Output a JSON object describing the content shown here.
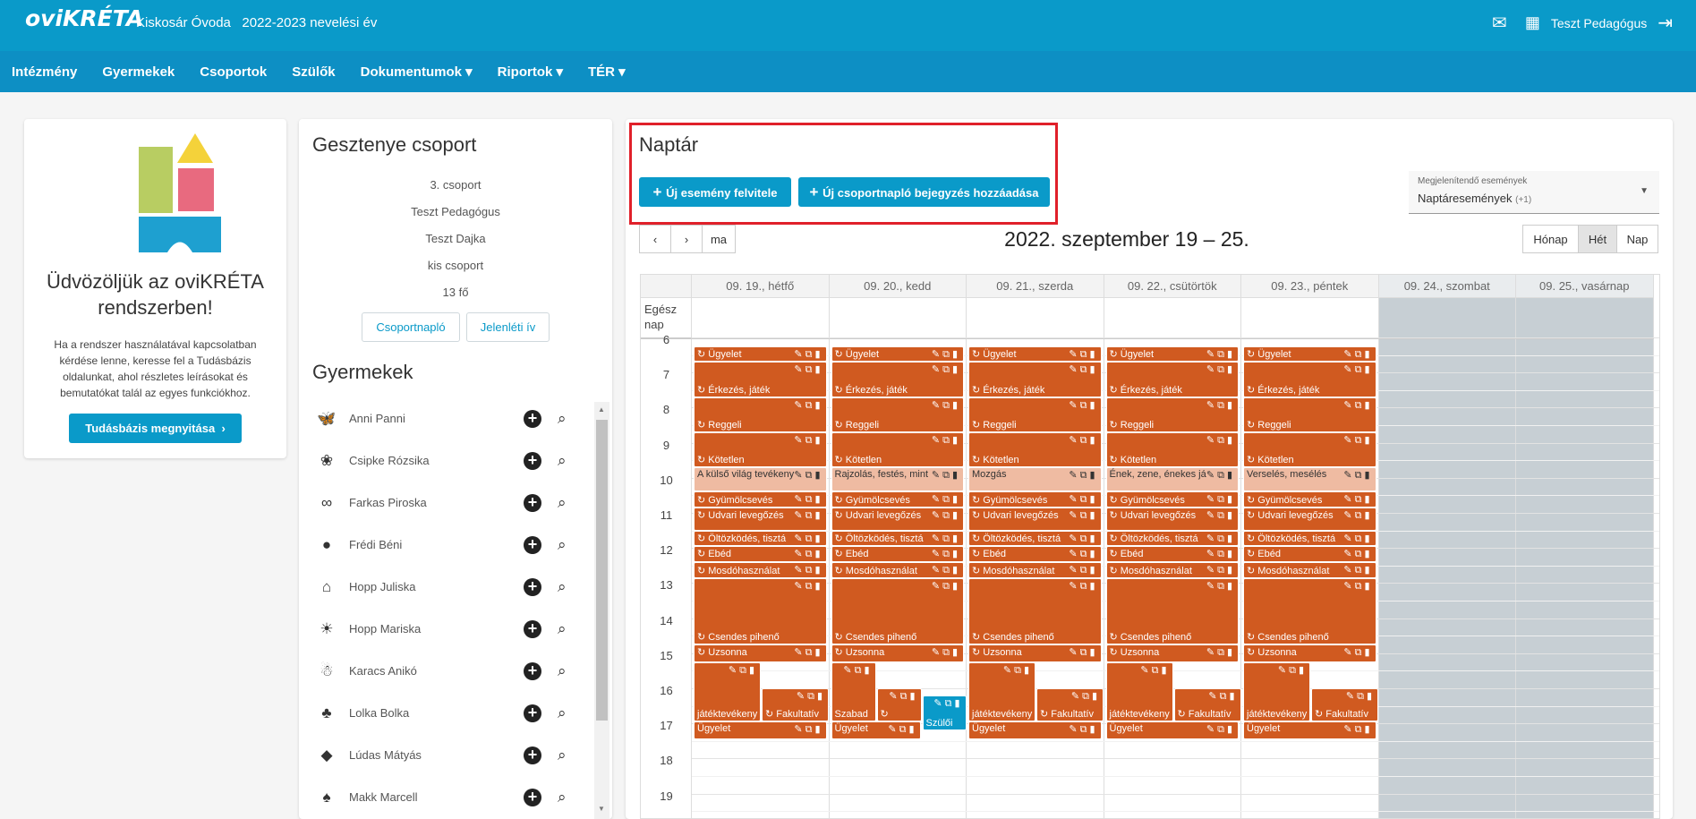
{
  "header": {
    "logo": "oviKRÉTA",
    "institution": "Kiskosár Óvoda",
    "year": "2022-2023 nevelési év",
    "user": "Teszt Pedagógus"
  },
  "nav": [
    {
      "label": "Intézmény"
    },
    {
      "label": "Gyermekek"
    },
    {
      "label": "Csoportok"
    },
    {
      "label": "Szülők"
    },
    {
      "label": "Dokumentumok ▾"
    },
    {
      "label": "Riportok ▾"
    },
    {
      "label": "TÉR ▾"
    }
  ],
  "welcome": {
    "title": "Üdvözöljük az oviKRÉTA rendszerben!",
    "text": "Ha a rendszer használatával kapcsolatban kérdése lenne, keresse fel a Tudásbázis oldalunkat, ahol részletes leírásokat és bemutatókat talál az egyes funkciókhoz.",
    "button": "Tudásbázis megnyitása"
  },
  "group": {
    "title": "Gesztenye csoport",
    "info": [
      "3. csoport",
      "Teszt Pedagógus",
      "Teszt Dajka",
      "kis csoport",
      "13 fő"
    ],
    "btn_naplo": "Csoportnapló",
    "btn_jelenleti": "Jelenléti ív",
    "children_title": "Gyermekek",
    "children": [
      {
        "name": "Anni Panni",
        "icon": "butterfly-icon",
        "glyph": "🦋"
      },
      {
        "name": "Csipke Rózsika",
        "icon": "flower-icon",
        "glyph": "❀"
      },
      {
        "name": "Farkas Piroska",
        "icon": "pretzel-icon",
        "glyph": "∞"
      },
      {
        "name": "Frédi Béni",
        "icon": "apple-icon",
        "glyph": "●"
      },
      {
        "name": "Hopp Juliska",
        "icon": "house-icon",
        "glyph": "⌂"
      },
      {
        "name": "Hopp Mariska",
        "icon": "sun-icon",
        "glyph": "☀"
      },
      {
        "name": "Karacs Anikó",
        "icon": "snowman-icon",
        "glyph": "☃"
      },
      {
        "name": "Lolka Bolka",
        "icon": "mushroom-icon",
        "glyph": "♣"
      },
      {
        "name": "Lúdas Mátyás",
        "icon": "duck-icon",
        "glyph": "◆"
      },
      {
        "name": "Makk Marcell",
        "icon": "tree-icon",
        "glyph": "♠"
      }
    ]
  },
  "calendar": {
    "title": "Naptár",
    "btn_new_event": "Új esemény felvitele",
    "btn_new_entry": "Új csoportnapló bejegyzés hozzáadása",
    "filter_label": "Megjelenítendő események",
    "filter_value": "Naptáresemények",
    "filter_more": "(+1)",
    "range": "2022. szeptember 19 – 25.",
    "today": "ma",
    "views": {
      "month": "Hónap",
      "week": "Hét",
      "day": "Nap"
    },
    "allday": "Egész nap",
    "days": [
      "09. 19., hétfő",
      "09. 20., kedd",
      "09. 21., szerda",
      "09. 22., csütörtök",
      "09. 23., péntek",
      "09. 24., szombat",
      "09. 25., vasárnap"
    ],
    "hours": [
      "6",
      "7",
      "8",
      "9",
      "10",
      "11",
      "12",
      "13",
      "14",
      "15",
      "16",
      "17",
      "18",
      "19"
    ],
    "special": [
      "A külső világ tevékeny",
      "Rajzolás, festés, mint",
      "Mozgás",
      "Ének, zene, énekes já",
      "Verselés, mesélés"
    ],
    "ev": {
      "ugyelet": "↻ Ügyelet",
      "erkezes": "↻ Érkezés, játék",
      "reggeli": "↻ Reggeli",
      "kotetlen": "↻ Kötetlen",
      "gyumolcs": "↻ Gyümölcsevés",
      "udvari": "↻ Udvari levegőzés",
      "oltozkodes": "↻ Öltözködés, tisztá",
      "ebed": "↻ Ebéd",
      "mosdo": "↻ Mosdóhasználat",
      "csendes": "↻ Csendes pihenő",
      "uzsonna": "↻ Uzsonna",
      "szabad1": "↻ Szabad",
      "szabad2": "játéktevékeny",
      "szabad_short": "Szabad",
      "fakultativ": "↻ Fakultatív",
      "szuloi": "Szülői",
      "ugyelet2": "Ügyelet",
      "loop": "↻"
    }
  }
}
